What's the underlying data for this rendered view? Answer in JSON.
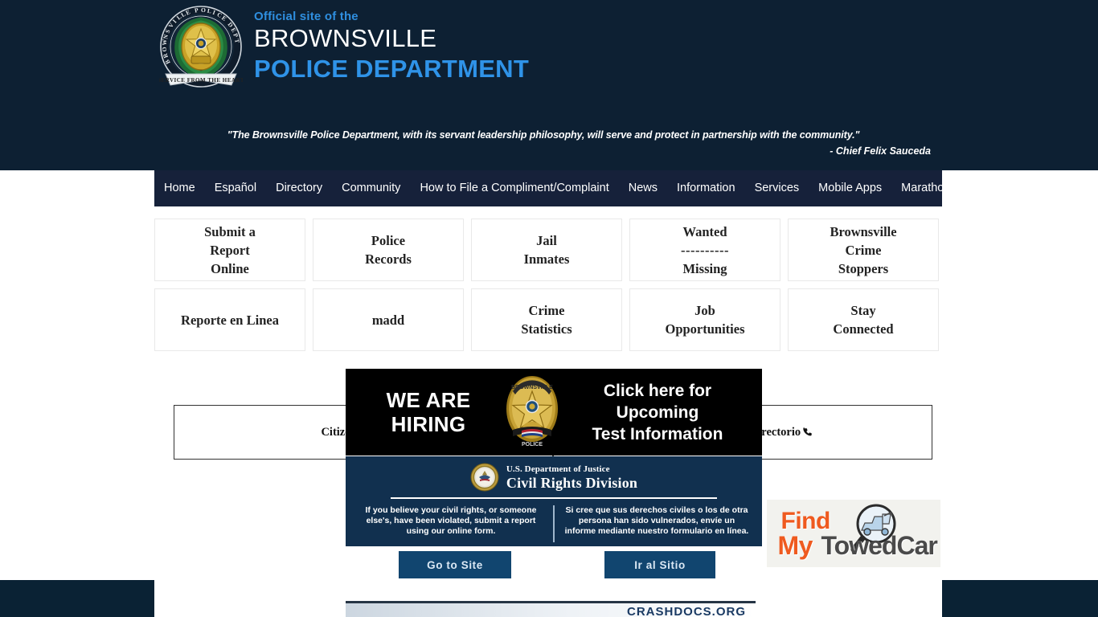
{
  "header": {
    "official_line": "Official site of the",
    "city": "BROWNSVILLE",
    "department": "POLICE DEPARTMENT",
    "logo_alt": "brownsville-police-department-badge",
    "logo_ring_text": "BROWNSVILLE POLICE DEPARTMENT",
    "logo_ribbon_text": "SERVICE FROM THE HEART",
    "accent_blue": "#2f93e8",
    "background": "#0d2033"
  },
  "quote": {
    "text": "\"The Brownsville Police Department, with its servant leadership philosophy, will serve and protect in partnership with the community.\"",
    "attribution": "- Chief Felix Sauceda"
  },
  "nav": {
    "background": "#16213a",
    "items": [
      {
        "label": "Home"
      },
      {
        "label": "Español"
      },
      {
        "label": "Directory"
      },
      {
        "label": "Community"
      },
      {
        "label": "How to File a Compliment/Complaint"
      },
      {
        "label": "News"
      },
      {
        "label": "Information"
      },
      {
        "label": "Services"
      },
      {
        "label": "Mobile Apps"
      },
      {
        "label": "Marathon"
      }
    ]
  },
  "tiles": {
    "row1": [
      {
        "line1": "Submit a",
        "line2": "Report",
        "line3": "Online"
      },
      {
        "line1": "Police",
        "line2": "Records",
        "line3": ""
      },
      {
        "line1": "Jail",
        "line2": "Inmates",
        "line3": ""
      },
      {
        "line1": "Wanted",
        "divider": "----------",
        "line3": "Missing"
      },
      {
        "line1": "Brownsville",
        "line2": "Crime",
        "line3": "Stoppers"
      }
    ],
    "row2": [
      {
        "line1": "Reporte en Linea",
        "line2": "",
        "line3": ""
      },
      {
        "line1": "madd",
        "line2": "",
        "line3": ""
      },
      {
        "line1": "Crime",
        "line2": "Statistics",
        "line3": ""
      },
      {
        "line1": "Job",
        "line2": "Opportunities",
        "line3": ""
      },
      {
        "line1": "Stay",
        "line2": "Connected",
        "line3": ""
      }
    ]
  },
  "link_row": {
    "left_label": "Citizens Connect",
    "right_label": "BPD Directory/Directorio",
    "right_icon": "phone-icon"
  },
  "hiring_banner": {
    "left_line1": "WE ARE",
    "left_line2": "HIRING",
    "right_line1": "Click here for",
    "right_line2": "Upcoming",
    "right_line3": "Test Information",
    "badge_alt": "brownsville-police-star-badge",
    "background": "#000000"
  },
  "doj_banner": {
    "agency": "U.S. Department of Justice",
    "division": "Civil Rights Division",
    "seal_alt": "doj-seal",
    "english_text": "If you believe your civil rights, or someone else's, have been violated, submit a report using our online form.",
    "spanish_text": "Si cree que sus derechos civiles o los de otra persona han sido vulnerados, envíe un informe mediante nuestro formulario en línea.",
    "background": "#11304f"
  },
  "buttons": {
    "go_to_site": "Go to Site",
    "ir_al_sitio": "Ir al Sitio",
    "button_color": "#11456f"
  },
  "towed_car": {
    "word1": "Find",
    "word2": "My",
    "word3": "TowedCar",
    "icon_alt": "magnifying-glass-tow-truck-icon",
    "orange": "#ef5a1f",
    "gray": "#4a4a4a"
  },
  "crashdocs": {
    "label": "CRASHDOCS.ORG"
  },
  "footer": {
    "band_color": "#0a2234"
  }
}
